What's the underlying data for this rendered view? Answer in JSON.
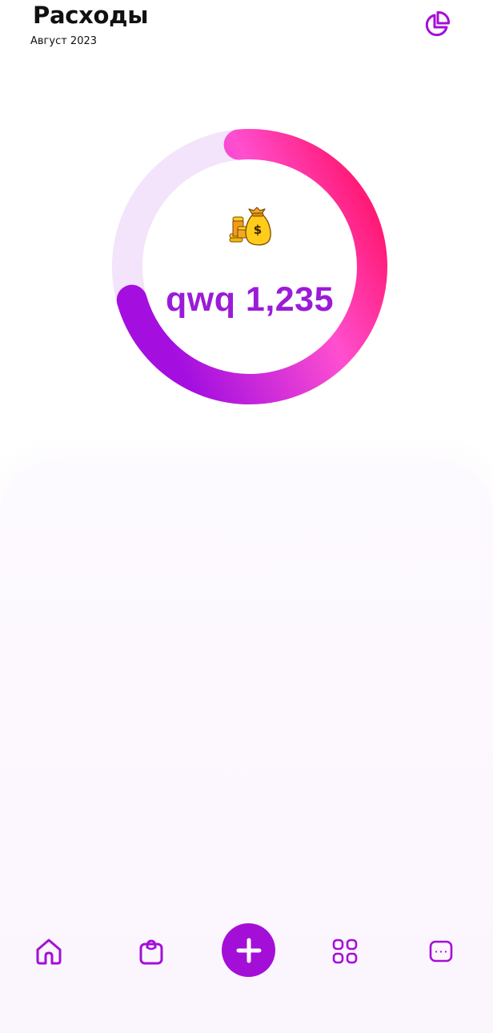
{
  "header": {
    "title": "Расходы",
    "subtitle": "Август 2023",
    "stats_icon": "pie-chart-icon"
  },
  "summary": {
    "amount_text": "qwq 1,235",
    "icon": "money-bag-icon",
    "ring_fill_fraction": 0.72
  },
  "colors": {
    "accent": "#a40fd8",
    "amount": "#9b1bd8",
    "ring_track": "#f3e3fb",
    "ring_gradient_start": "#a40fe0",
    "ring_gradient_mid": "#ff4fd0",
    "ring_gradient_end": "#ff0a5a"
  },
  "bottom_nav": {
    "items": [
      {
        "icon": "home-icon"
      },
      {
        "icon": "shopping-bag-icon"
      },
      {
        "icon": "plus-icon"
      },
      {
        "icon": "grid-icon"
      },
      {
        "icon": "more-icon"
      }
    ]
  }
}
